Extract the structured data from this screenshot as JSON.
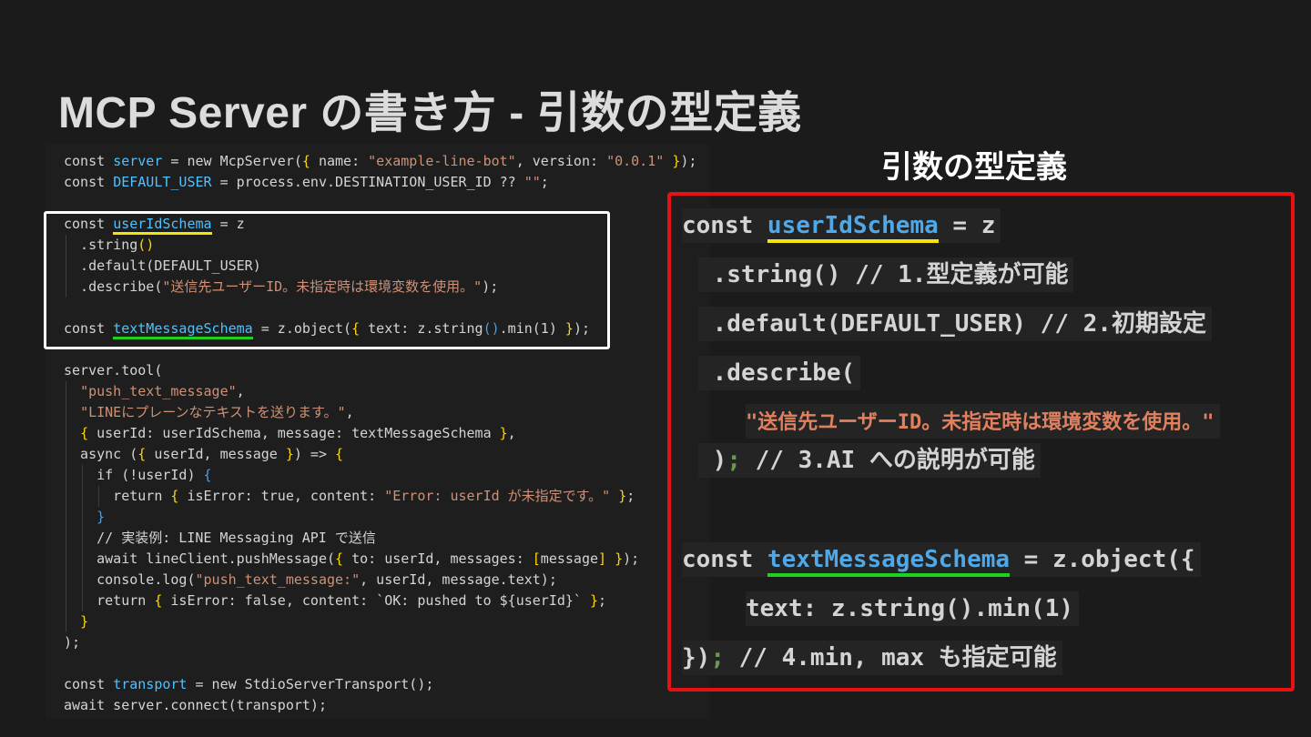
{
  "slide": {
    "title": "MCP Server の書き方 - 引数の型定義"
  },
  "code_panel": {
    "lines": [
      [
        {
          "text": "const "
        },
        {
          "text": "server",
          "cls": "c-ident"
        },
        {
          "text": " = new McpServer("
        },
        {
          "text": "{",
          "cls": "c-bracket"
        },
        {
          "text": " name: "
        },
        {
          "text": "\"example-line-bot\"",
          "cls": "c-str"
        },
        {
          "text": ", version: "
        },
        {
          "text": "\"0.0.1\"",
          "cls": "c-str"
        },
        {
          "text": " "
        },
        {
          "text": "}",
          "cls": "c-bracket"
        },
        {
          "text": ");"
        }
      ],
      [
        {
          "text": "const "
        },
        {
          "text": "DEFAULT_USER",
          "cls": "c-ident"
        },
        {
          "text": " = process.env.DESTINATION_USER_ID ?? "
        },
        {
          "text": "\"\"",
          "cls": "c-str"
        },
        {
          "text": ";"
        }
      ],
      [],
      [
        {
          "text": "const "
        },
        {
          "text": "userIdSchema",
          "cls": "c-ident",
          "u": "yellow"
        },
        {
          "text": " = z"
        }
      ],
      [
        {
          "text": "  .string"
        },
        {
          "text": "()",
          "cls": "c-bracket"
        }
      ],
      [
        {
          "text": "  .default(DEFAULT_USER)"
        }
      ],
      [
        {
          "text": "  .describe("
        },
        {
          "text": "\"送信先ユーザーID。未指定時は環境変数を使用。\"",
          "cls": "c-str"
        },
        {
          "text": ");"
        }
      ],
      [],
      [
        {
          "text": "const "
        },
        {
          "text": "textMessageSchema",
          "cls": "c-ident",
          "u": "green"
        },
        {
          "text": " = z.object("
        },
        {
          "text": "{",
          "cls": "c-bracket"
        },
        {
          "text": " text: z.string"
        },
        {
          "text": "()",
          "cls": "c-blue"
        },
        {
          "text": ".min(1) "
        },
        {
          "text": "}",
          "cls": "c-bracket"
        },
        {
          "text": ");"
        }
      ],
      [],
      [
        {
          "text": "server.tool("
        }
      ],
      [
        {
          "text": "  "
        },
        {
          "text": "\"push_text_message\"",
          "cls": "c-str"
        },
        {
          "text": ","
        }
      ],
      [
        {
          "text": "  "
        },
        {
          "text": "\"LINEにプレーンなテキストを送ります。\"",
          "cls": "c-str"
        },
        {
          "text": ","
        }
      ],
      [
        {
          "text": "  "
        },
        {
          "text": "{",
          "cls": "c-bracket"
        },
        {
          "text": " userId: userIdSchema, message: textMessageSchema "
        },
        {
          "text": "}",
          "cls": "c-bracket"
        },
        {
          "text": ","
        }
      ],
      [
        {
          "text": "  async ("
        },
        {
          "text": "{",
          "cls": "c-bracket"
        },
        {
          "text": " userId, message "
        },
        {
          "text": "}",
          "cls": "c-bracket"
        },
        {
          "text": ") => "
        },
        {
          "text": "{",
          "cls": "c-bracket"
        }
      ],
      [
        {
          "text": "    if (!userId) "
        },
        {
          "text": "{",
          "cls": "c-blue"
        }
      ],
      [
        {
          "text": "      return "
        },
        {
          "text": "{",
          "cls": "c-bracket"
        },
        {
          "text": " isError: true, content: "
        },
        {
          "text": "\"Error: userId が未指定です。\"",
          "cls": "c-str"
        },
        {
          "text": " "
        },
        {
          "text": "}",
          "cls": "c-bracket"
        },
        {
          "text": ";"
        }
      ],
      [
        {
          "text": "    "
        },
        {
          "text": "}",
          "cls": "c-blue"
        }
      ],
      [
        {
          "text": "    // 実装例: LINE Messaging API で送信"
        }
      ],
      [
        {
          "text": "    await lineClient.pushMessage("
        },
        {
          "text": "{",
          "cls": "c-bracket"
        },
        {
          "text": " to: userId, messages: "
        },
        {
          "text": "[",
          "cls": "c-bracket"
        },
        {
          "text": "message"
        },
        {
          "text": "]",
          "cls": "c-bracket"
        },
        {
          "text": " "
        },
        {
          "text": "}",
          "cls": "c-bracket"
        },
        {
          "text": ");"
        }
      ],
      [
        {
          "text": "    console.log("
        },
        {
          "text": "\"push_text_message:\"",
          "cls": "c-str"
        },
        {
          "text": ", userId, message.text);"
        }
      ],
      [
        {
          "text": "    return "
        },
        {
          "text": "{",
          "cls": "c-bracket"
        },
        {
          "text": " isError: false, content: `OK: pushed to ${userId}` "
        },
        {
          "text": "}",
          "cls": "c-bracket"
        },
        {
          "text": ";"
        }
      ],
      [
        {
          "text": "  "
        },
        {
          "text": "}",
          "cls": "c-bracket"
        }
      ],
      [
        {
          "text": ");"
        }
      ],
      [],
      [
        {
          "text": "const "
        },
        {
          "text": "transport",
          "cls": "c-ident"
        },
        {
          "text": " = new StdioServerTransport();"
        }
      ],
      [
        {
          "text": "await server.connect(transport);"
        }
      ]
    ]
  },
  "explain": {
    "title": "引数の型定義",
    "lines": [
      [
        {
          "text": "const "
        },
        {
          "text": "userIdSchema",
          "cls": "ident",
          "u": "yellow"
        },
        {
          "text": " = z"
        }
      ],
      [
        {
          "text": " .string() // 1.型定義が可能"
        }
      ],
      [
        {
          "text": " .default(DEFAULT_USER) // 2.初期設定"
        }
      ],
      [
        {
          "text": " .describe("
        }
      ],
      [
        {
          "text": "\"送信先ユーザーID。未指定時は環境変数を使用。\"",
          "cls": "str"
        }
      ],
      [
        {
          "text": " )"
        },
        {
          "text": ";",
          "cls": "semi"
        },
        {
          "text": " // 3.AI への説明が可能"
        }
      ],
      [
        {
          "text": "const "
        },
        {
          "text": "textMessageSchema",
          "cls": "ident",
          "u": "green"
        },
        {
          "text": " = z.object({"
        }
      ],
      [
        {
          "text": "text: z.string().min(1)"
        }
      ],
      [
        {
          "text": "})"
        },
        {
          "text": ";",
          "cls": "semi"
        },
        {
          "text": " // 4.min, max も指定可能"
        }
      ]
    ]
  }
}
